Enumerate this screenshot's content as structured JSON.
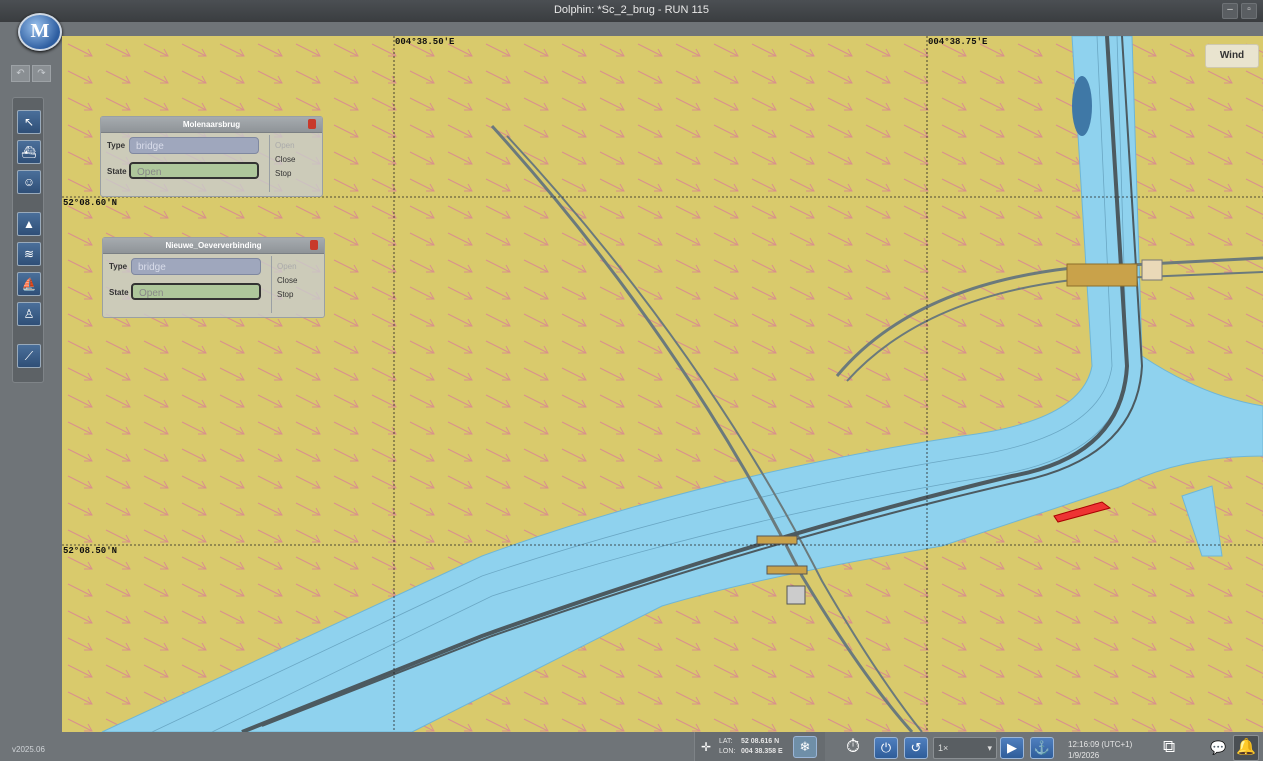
{
  "window": {
    "title": "Dolphin: *Sc_2_brug - RUN 115",
    "minimize": "–",
    "restore": "▫"
  },
  "logo": {
    "text": "M"
  },
  "version": "v2025.06",
  "map": {
    "lon_labels": [
      "004°38.50'E",
      "004°38.75'E"
    ],
    "lat_labels": [
      "52°08.60'N",
      "52°08.50'N"
    ],
    "wind_tab": "Wind",
    "colors": {
      "land": "#d9ca6c",
      "water": "#8fd2ee",
      "arrows": "#d48a8a",
      "track": "#5f6b70",
      "own_ship": "#e33"
    }
  },
  "bridges": [
    {
      "name": "Molenaarsbrug",
      "type_label": "Type",
      "type_value": "bridge",
      "state_label": "State",
      "state_value": "Open",
      "actions": [
        "Open",
        "Close",
        "Stop"
      ]
    },
    {
      "name": "Nieuwe_Oeververbinding",
      "type_label": "Type",
      "type_value": "bridge",
      "state_label": "State",
      "state_value": "Open",
      "actions": [
        "Open",
        "Close",
        "Stop"
      ]
    }
  ],
  "tools": [
    "pointer-tool",
    "ship-tool",
    "operator-tool",
    "buoy-tool",
    "current-tool",
    "tug-tool",
    "person-tool",
    "measure-tool"
  ],
  "status": {
    "lat_label": "LAT:",
    "lat_value": "52 08.616 N",
    "lon_label": "LON:",
    "lon_value": "004 38.358 E",
    "speed": "1×",
    "time": "12:16:09",
    "tz": "(UTC+1)",
    "date": "1/9/2026"
  }
}
